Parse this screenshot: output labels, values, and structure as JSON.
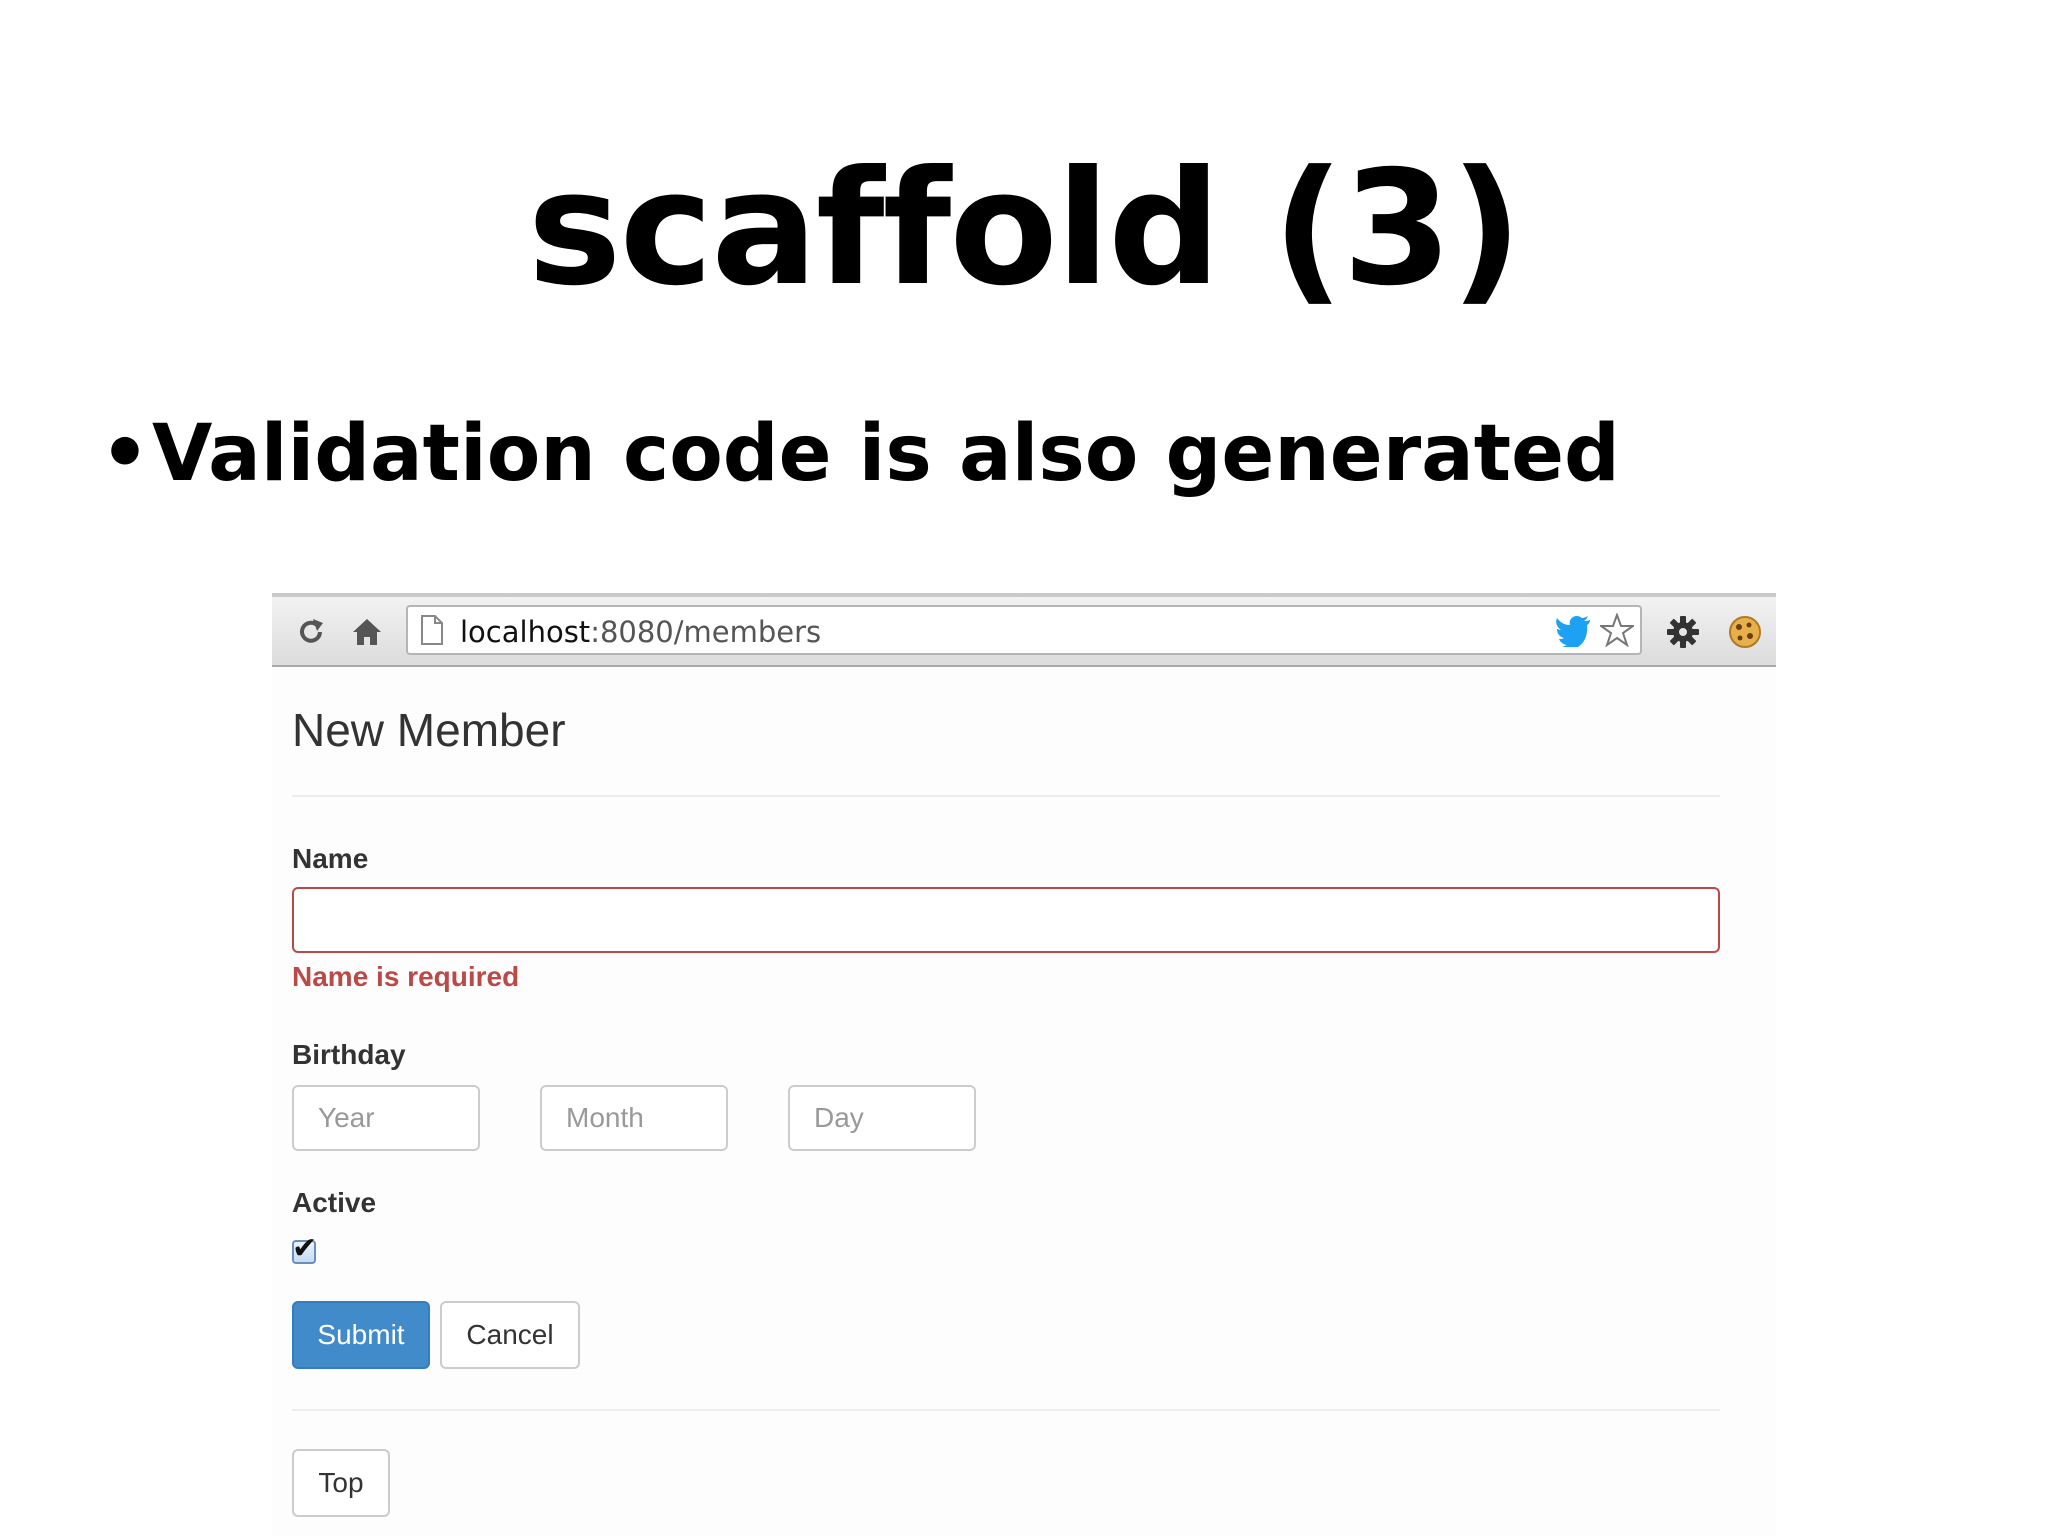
{
  "slide": {
    "title": "scaffold (3)",
    "bullet_symbol": "•",
    "bullet": "Validation code is also generated"
  },
  "browser": {
    "url_host": "localhost",
    "url_rest": ":8080/members",
    "icons": [
      "reload-icon",
      "home-icon",
      "page-icon",
      "twitter-icon",
      "star-icon",
      "gear-icon",
      "cookie-icon"
    ]
  },
  "form": {
    "heading": "New Member",
    "name_label": "Name",
    "name_value": "",
    "name_error": "Name is required",
    "birthday_label": "Birthday",
    "year_placeholder": "Year",
    "month_placeholder": "Month",
    "day_placeholder": "Day",
    "active_label": "Active",
    "active_checked": true,
    "submit_label": "Submit",
    "cancel_label": "Cancel",
    "top_label": "Top"
  },
  "colors": {
    "error": "#b94a48",
    "primary": "#428bca",
    "twitter": "#1da1f2"
  }
}
